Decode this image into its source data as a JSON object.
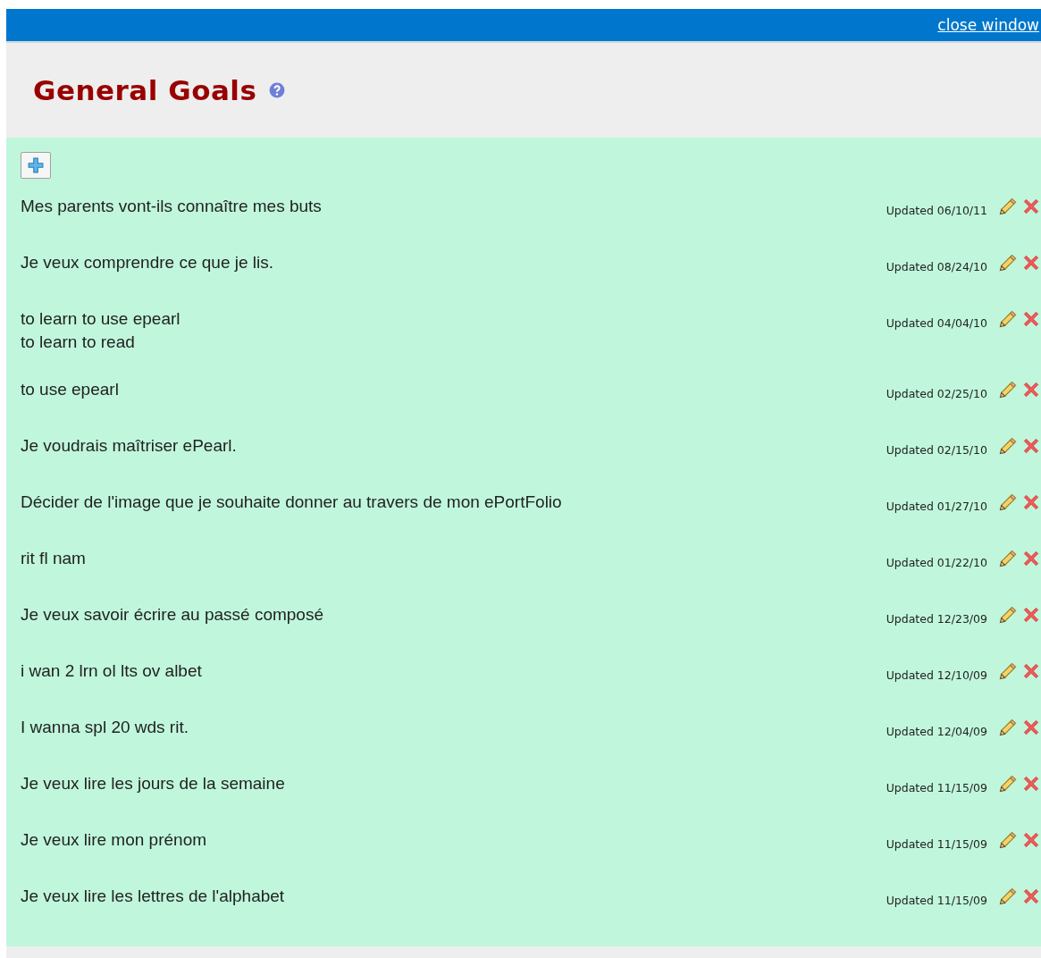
{
  "top_bar": {
    "link": "close window"
  },
  "header": {
    "title": "General Goals"
  },
  "goals": [
    {
      "lines": [
        "Mes parents vont-ils connaître mes buts"
      ],
      "updated": "Updated 06/10/11"
    },
    {
      "lines": [
        "Je veux comprendre ce que je lis."
      ],
      "updated": "Updated 08/24/10"
    },
    {
      "lines": [
        "to learn to use epearl",
        "to learn to read"
      ],
      "updated": "Updated 04/04/10"
    },
    {
      "lines": [
        "to use epearl"
      ],
      "updated": "Updated 02/25/10"
    },
    {
      "lines": [
        "Je voudrais maîtriser ePearl."
      ],
      "updated": "Updated 02/15/10"
    },
    {
      "lines": [
        "Décider de l'image que je souhaite donner au travers de mon ePortFolio"
      ],
      "updated": "Updated 01/27/10"
    },
    {
      "lines": [
        "rit fl nam"
      ],
      "updated": "Updated 01/22/10"
    },
    {
      "lines": [
        "Je veux savoir écrire au passé composé"
      ],
      "updated": "Updated 12/23/09"
    },
    {
      "lines": [
        "i wan 2 lrn ol lts ov albet"
      ],
      "updated": "Updated 12/10/09"
    },
    {
      "lines": [
        "I wanna spl 20 wds rit."
      ],
      "updated": "Updated 12/04/09"
    },
    {
      "lines": [
        "Je veux lire les jours de la semaine"
      ],
      "updated": "Updated 11/15/09"
    },
    {
      "lines": [
        "Je veux lire mon prénom"
      ],
      "updated": "Updated 11/15/09"
    },
    {
      "lines": [
        "Je veux lire les lettres de l'alphabet"
      ],
      "updated": "Updated 11/15/09"
    }
  ]
}
